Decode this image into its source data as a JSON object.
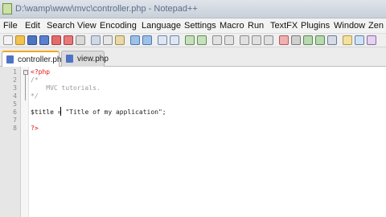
{
  "window": {
    "title": "D:\\wamp\\www\\mvc\\controller.php - Notepad++"
  },
  "menu": [
    "File",
    "Edit",
    "Search",
    "View",
    "Encoding",
    "Language",
    "Settings",
    "Macro",
    "Run",
    "TextFX",
    "Plugins",
    "Window",
    "Zen C"
  ],
  "tabs": [
    {
      "label": "controller.php",
      "active": true,
      "icon": "saved-file-icon"
    },
    {
      "label": "view.php",
      "active": false,
      "icon": "saved-file-icon"
    }
  ],
  "editor": {
    "line_numbers": [
      "1",
      "2",
      "3",
      "4",
      "5",
      "6",
      "7",
      "8"
    ],
    "lines": [
      {
        "num": "1",
        "tokens": [
          {
            "t": "<?php",
            "c": "php"
          }
        ]
      },
      {
        "num": "2",
        "tokens": [
          {
            "t": "/*",
            "c": "comment"
          }
        ]
      },
      {
        "num": "3",
        "tokens": [
          {
            "t": "    MVC tutorials.",
            "c": "comment"
          }
        ]
      },
      {
        "num": "4",
        "tokens": [
          {
            "t": "*/",
            "c": "comment"
          }
        ]
      },
      {
        "num": "5",
        "tokens": []
      },
      {
        "num": "6",
        "tokens": [
          {
            "t": "$title ",
            "c": "var"
          },
          {
            "t": "= ",
            "c": "op"
          },
          {
            "t": "\"Title of my application\";",
            "c": "str"
          }
        ]
      },
      {
        "num": "7",
        "tokens": []
      },
      {
        "num": "8",
        "tokens": [
          {
            "t": "?>",
            "c": "php"
          }
        ]
      }
    ]
  },
  "colors": {
    "php_tag": "#e21212",
    "comment": "#9a9a9a",
    "active_tab_accent": "#f5a623"
  }
}
